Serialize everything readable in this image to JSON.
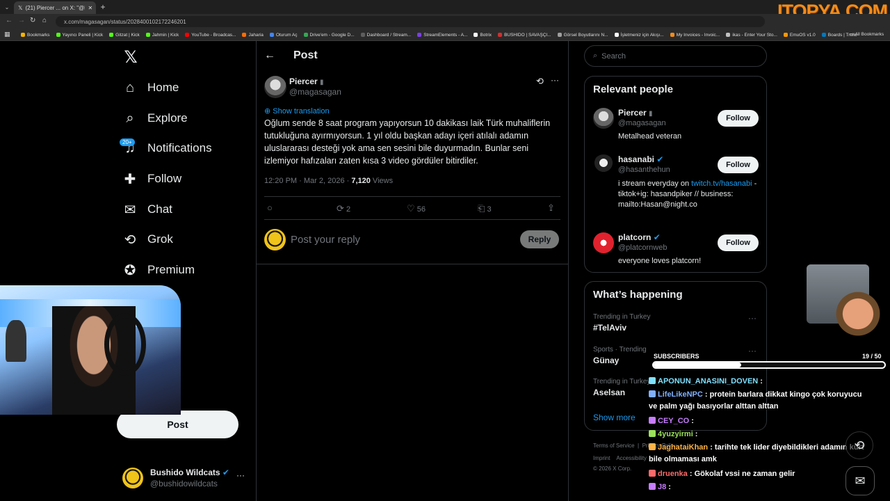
{
  "browser": {
    "tab_title": "(21) Piercer ... on X: \"@hasanabi ...",
    "new_tab": "+",
    "url": "x.com/magasagan/status/2028400102172246201",
    "bookmarks": [
      "Bookmarks",
      "Yayıncı Paneli | Kick",
      "Gitzat | Kick",
      "Jahmin | Kick",
      "YouTube - Broadcas...",
      "Jaharia",
      "Oturum Aç",
      "Drive'em - Google D...",
      "Dashboard / Stream...",
      "StreamElements - A...",
      "Botrix",
      "BUSHIDO | SAVAŞÇI...",
      "Görsel Boyutlarını N...",
      "İşletmeniz için Akışı...",
      "My Invoices - Invoic...",
      "ikas - Enter Your Sto...",
      "EmuOS v1.0",
      "Boards | Trello"
    ],
    "all_bookmarks": "All Bookmarks",
    "brand_watermark": "itopya.com"
  },
  "nav": {
    "items": [
      {
        "label": "Home",
        "icon": "home-icon"
      },
      {
        "label": "Explore",
        "icon": "search-icon"
      },
      {
        "label": "Notifications",
        "icon": "bell-icon"
      },
      {
        "label": "Follow",
        "icon": "follow-icon"
      },
      {
        "label": "Chat",
        "icon": "mail-icon"
      },
      {
        "label": "Grok",
        "icon": "grok-icon"
      },
      {
        "label": "Premium",
        "icon": "premium-icon"
      },
      {
        "label": "arks",
        "icon": "bookmark-icon"
      },
      {
        "label": "s",
        "icon": "communities-icon"
      }
    ],
    "notif_badge": "20+",
    "post_button": "Post",
    "account": {
      "name": "Bushido Wildcats",
      "handle": "@bushidowildcats",
      "more": "···"
    }
  },
  "post": {
    "header": "Post",
    "author_name": "Piercer",
    "author_handle": "@magasagan",
    "more": "···",
    "show_translation": "Show translation",
    "text": "Oğlum sende 8 saat program yapıyorsun 10 dakikası laik Türk muhaliflerin tutukluğuna ayırmıyorsun. 1 yıl oldu başkan adayı içeri atılalı adamın uluslararası desteği yok ama sen sesini bile duyurmadın. Bunlar seni izlemiyor hafızaları zaten kısa 3 video gördüler bitirdiler.",
    "time": "12:20 PM · Mar 2, 2026 · ",
    "views": "7,120",
    "views_label": " Views",
    "retweets": "2",
    "likes": "56",
    "bookmarks": "3",
    "reply_placeholder": "Post your reply",
    "reply_button": "Reply"
  },
  "search": {
    "placeholder": "Search"
  },
  "relevant": {
    "title": "Relevant people",
    "follow_label": "Follow",
    "people": [
      {
        "name": "Piercer",
        "handle": "@magasagan",
        "bio": "Metalhead veteran",
        "verified": false
      },
      {
        "name": "hasanabi",
        "handle": "@hasanthehun",
        "bio_pre": "i stream everyday on ",
        "bio_link": "twitch.tv/hasanabi",
        "bio_post": " - tiktok+ig: hasandpiker // business: mailto:Hasan@night.co",
        "verified": true
      },
      {
        "name": "platcorn",
        "handle": "@platcornweb",
        "bio": "everyone loves platcorn!",
        "verified": true
      }
    ]
  },
  "happening": {
    "title": "What’s happening",
    "trends": [
      {
        "context": "Trending in Turkey",
        "name": "#TelAviv"
      },
      {
        "context": "Sports · Trending",
        "name": "Günay"
      },
      {
        "context": "Trending in Turkey",
        "name": "Aselsan"
      }
    ],
    "show_more": "Show more"
  },
  "footer": {
    "links": [
      "Terms of Service",
      "|",
      "Privacy Policy",
      "Imprint",
      "Accessibility"
    ],
    "copyright": "© 2026 X Corp."
  },
  "overlay": {
    "subscribers_label": "SUBSCRIBERS",
    "subscribers_count": "19",
    "subscribers_goal": "/ 50",
    "subscribers_progress": 0.38,
    "chat": [
      {
        "user": "APONUN_ANASINI_DOVEN",
        "color": "#7fe0ff",
        "msg": ""
      },
      {
        "user": "LifeLikeNPC",
        "color": "#7fb0ff",
        "msg": "protein barlara dikkat kingo çok koruyucu ve palm yağı basıyorlar alttan alttan"
      },
      {
        "user": "CEY_CO",
        "color": "#c77dff",
        "msg": ""
      },
      {
        "user": "4yuzyirmi",
        "color": "#9be35a",
        "msg": ""
      },
      {
        "user": "JaghataiKhan",
        "color": "#ffb347",
        "msg": "tarihte tek lider diyebildikleri adamın kurt bile olmaması amk"
      },
      {
        "user": "druenka",
        "color": "#ff6a6a",
        "msg": "Gökolaf vssi ne zaman gelir"
      },
      {
        "user": "J8",
        "color": "#c77dff",
        "msg": ""
      }
    ]
  }
}
